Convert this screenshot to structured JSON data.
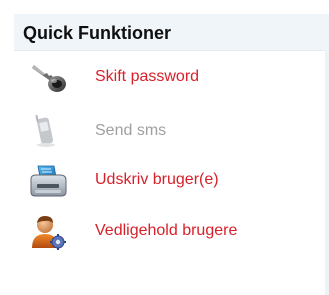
{
  "panel": {
    "title": "Quick Funktioner",
    "items": [
      {
        "label": "Skift password",
        "icon": "key-icon",
        "enabled": true
      },
      {
        "label": "Send sms",
        "icon": "mobile-phone-icon",
        "enabled": false
      },
      {
        "label": "Udskriv bruger(e)",
        "icon": "printer-icon",
        "enabled": true
      },
      {
        "label": "Vedligehold brugere",
        "icon": "user-settings-icon",
        "enabled": true
      }
    ]
  },
  "colors": {
    "link": "#d8202a",
    "disabled": "#a0a0a0",
    "header_bg": "#f0f5fa",
    "title": "#101010"
  }
}
